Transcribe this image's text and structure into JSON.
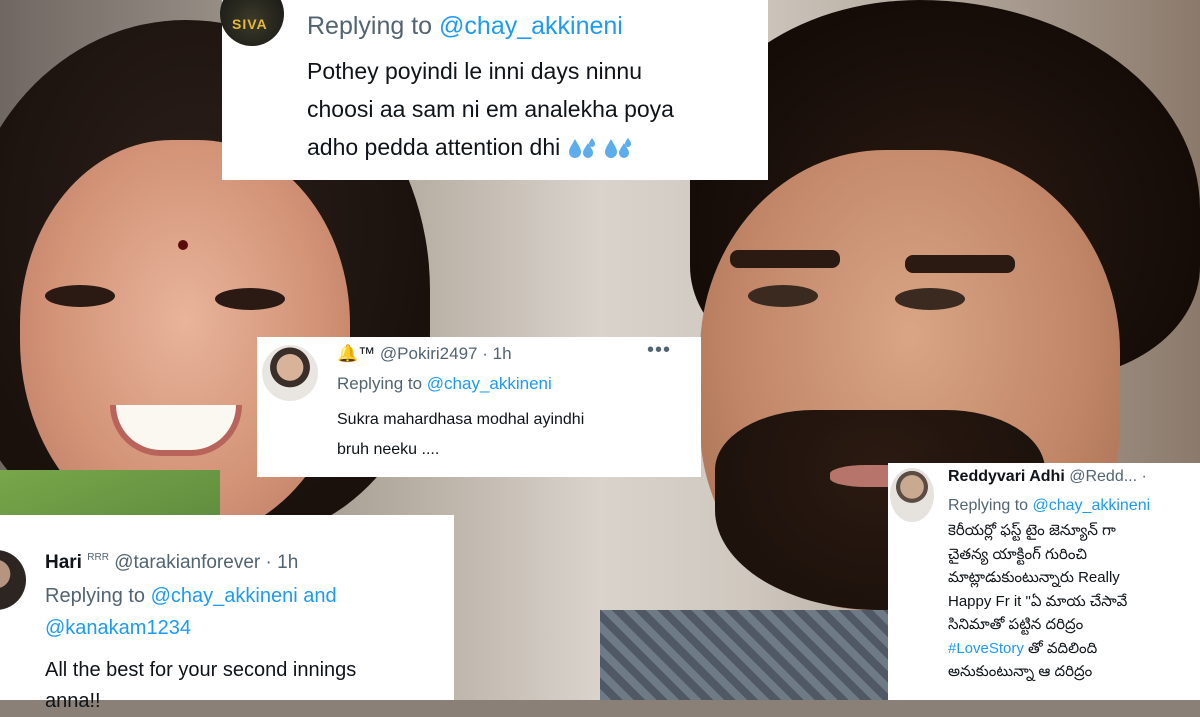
{
  "colors": {
    "link": "#1d9bf0",
    "text": "#0f1419",
    "muted": "#536471",
    "card_bg": "#ffffff"
  },
  "tweet_top": {
    "avatar_text": "SIVA",
    "replying_prefix": "Replying to",
    "replying_handle": "@chay_akkineni",
    "lines": [
      "Pothey poyindi le  inni days ninnu",
      "choosi aa sam ni em analekha poya",
      "adho pedda attention dhi"
    ],
    "emoji": "sweat-droplets-icon"
  },
  "tweet_mid": {
    "name_prefix": "🔔™",
    "handle": "@Pokiri2497",
    "time": "1h",
    "more": "•••",
    "replying_prefix": "Replying to",
    "replying_handle": "@chay_akkineni",
    "lines": [
      "Sukra mahardhasa modhal ayindhi",
      "bruh neeku ...."
    ]
  },
  "tweet_left": {
    "name": "Hari",
    "name_sup": "RRR",
    "handle": "@tarakianforever",
    "time": "1h",
    "replying_prefix": "Replying to",
    "replying_handle": "@chay_akkineni and",
    "replying_handle2": "@kanakam1234",
    "lines": [
      "All the best for your second innings",
      "anna!!"
    ]
  },
  "tweet_right": {
    "name": "Reddyvari Adhi",
    "handle": "@Redd...",
    "time": "·",
    "replying_prefix": "Replying to",
    "replying_handle": "@chay_akkineni",
    "lines": [
      "కెరీయర్లో ఫస్ట్ టైం జెన్యూన్ గా",
      "చైతన్య యాక్టింగ్ గురించి",
      "మాట్లాడుకుంటున్నారు Really",
      "Happy Fr it \"ఏ మాయ చేసావే",
      "సినిమాతో పట్టిన దరిద్రం",
      "#LoveStory",
      "అనుకుంటున్నా ఆ దరిద్రం"
    ],
    "line6_suffix": " తో వదిలింది"
  }
}
